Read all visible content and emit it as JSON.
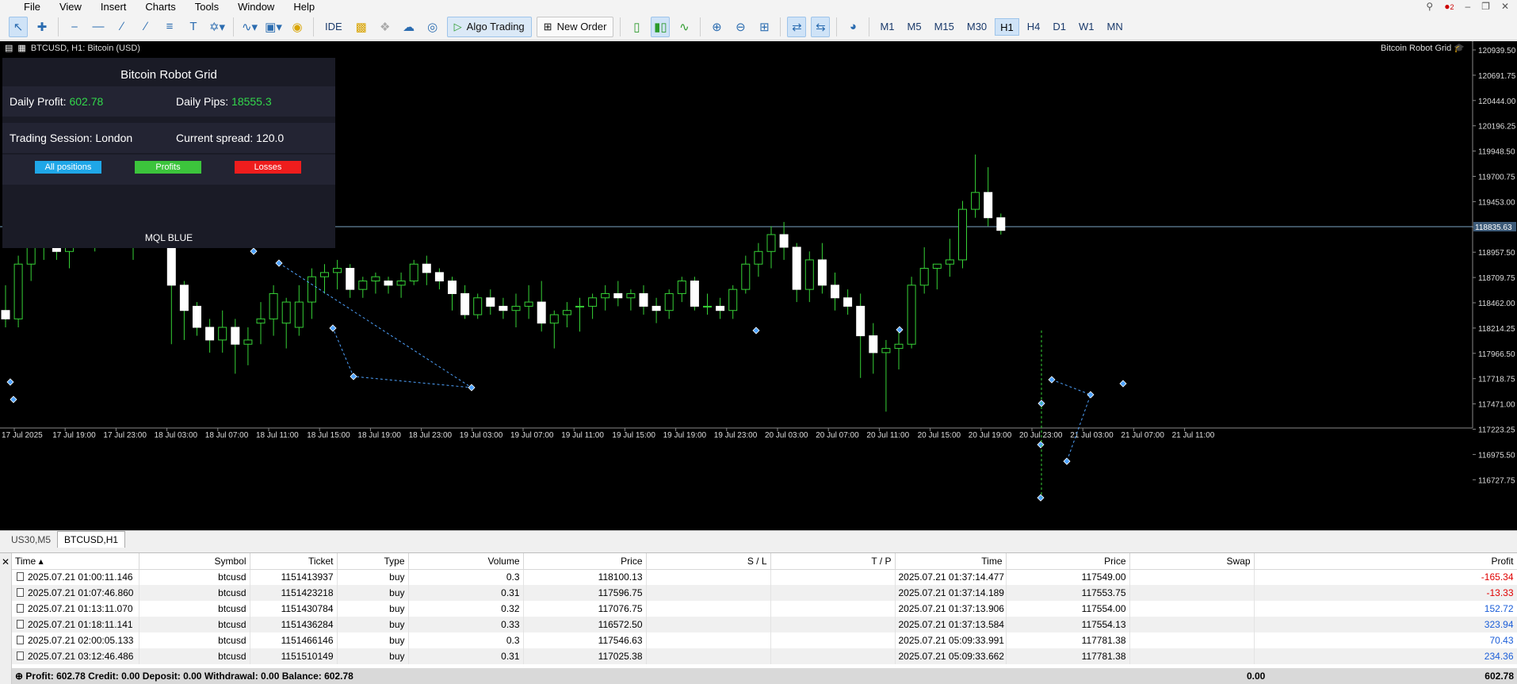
{
  "menu": [
    "File",
    "View",
    "Insert",
    "Charts",
    "Tools",
    "Window",
    "Help"
  ],
  "toolbar": {
    "ide": "IDE",
    "algo_trading": "Algo Trading",
    "new_order": "New Order",
    "timeframes": [
      "M1",
      "M5",
      "M15",
      "M30",
      "H1",
      "H4",
      "D1",
      "W1",
      "MN"
    ],
    "active_timeframe": "H1",
    "notification_count": "2"
  },
  "chart": {
    "label": "BTCUSD, H1:  Bitcoin (USD)",
    "right_label": "Bitcoin Robot Grid",
    "current_price": "118835.63",
    "price_ticks": [
      "120939.50",
      "120691.75",
      "120444.00",
      "120196.25",
      "119948.50",
      "119700.75",
      "119453.00",
      "119205.25",
      "118957.50",
      "118709.75",
      "118462.00",
      "118214.25",
      "117966.50",
      "117718.75",
      "117471.00",
      "117223.25",
      "116975.50",
      "116727.75"
    ],
    "time_ticks": [
      "17 Jul 2025",
      "17 Jul 19:00",
      "17 Jul 23:00",
      "18 Jul 03:00",
      "18 Jul 07:00",
      "18 Jul 11:00",
      "18 Jul 15:00",
      "18 Jul 19:00",
      "18 Jul 23:00",
      "19 Jul 03:00",
      "19 Jul 07:00",
      "19 Jul 11:00",
      "19 Jul 15:00",
      "19 Jul 19:00",
      "19 Jul 23:00",
      "20 Jul 03:00",
      "20 Jul 07:00",
      "20 Jul 11:00",
      "20 Jul 15:00",
      "20 Jul 19:00",
      "20 Jul 23:00",
      "21 Jul 03:00",
      "21 Jul 07:00",
      "21 Jul 11:00"
    ]
  },
  "panel": {
    "title": "Bitcoin Robot Grid",
    "daily_profit_label": "Daily Profit:",
    "daily_profit": "602.78",
    "daily_pips_label": "Daily Pips:",
    "daily_pips": "18555.3",
    "session_label": "Trading Session: London",
    "spread_label": "Current spread:",
    "spread": "120.0",
    "btn_all": "All positions",
    "btn_profits": "Profits",
    "btn_losses": "Losses",
    "brand": "MQL BLUE",
    "colors": {
      "all": "#1fa7e8",
      "profits": "#3cc43c",
      "losses": "#ef1d1d"
    }
  },
  "chart_tabs": [
    "US30,M5",
    "BTCUSD,H1"
  ],
  "trades": {
    "headers": [
      "Time",
      "Symbol",
      "Ticket",
      "Type",
      "Volume",
      "Price",
      "S / L",
      "T / P",
      "Time",
      "Price",
      "Swap",
      "Profit"
    ],
    "rows": [
      [
        "2025.07.21 01:00:11.146",
        "btcusd",
        "1151413937",
        "buy",
        "0.3",
        "118100.13",
        "",
        "",
        "2025.07.21 01:37:14.477",
        "117549.00",
        "",
        "-165.34"
      ],
      [
        "2025.07.21 01:07:46.860",
        "btcusd",
        "1151423218",
        "buy",
        "0.31",
        "117596.75",
        "",
        "",
        "2025.07.21 01:37:14.189",
        "117553.75",
        "",
        "-13.33"
      ],
      [
        "2025.07.21 01:13:11.070",
        "btcusd",
        "1151430784",
        "buy",
        "0.32",
        "117076.75",
        "",
        "",
        "2025.07.21 01:37:13.906",
        "117554.00",
        "",
        "152.72"
      ],
      [
        "2025.07.21 01:18:11.141",
        "btcusd",
        "1151436284",
        "buy",
        "0.33",
        "116572.50",
        "",
        "",
        "2025.07.21 01:37:13.584",
        "117554.13",
        "",
        "323.94"
      ],
      [
        "2025.07.21 02:00:05.133",
        "btcusd",
        "1151466146",
        "buy",
        "0.3",
        "117546.63",
        "",
        "",
        "2025.07.21 05:09:33.991",
        "117781.38",
        "",
        "70.43"
      ],
      [
        "2025.07.21 03:12:46.486",
        "btcusd",
        "1151510149",
        "buy",
        "0.31",
        "117025.38",
        "",
        "",
        "2025.07.21 05:09:33.662",
        "117781.38",
        "",
        "234.36"
      ]
    ],
    "footer": "Profit: 602.78  Credit: 0.00  Deposit: 0.00  Withdrawal: 0.00  Balance: 602.78",
    "footer_swap": "0.00",
    "footer_total": "602.78"
  },
  "chart_data": {
    "type": "candlestick",
    "ylim": [
      116600,
      121000
    ],
    "grid": false,
    "candles": [
      [
        117900,
        118200,
        117700,
        117800
      ],
      [
        117800,
        118550,
        117700,
        118450
      ],
      [
        118450,
        118900,
        118250,
        118800
      ],
      [
        118800,
        119100,
        118500,
        118950
      ],
      [
        118950,
        119050,
        118500,
        118600
      ],
      [
        118600,
        119000,
        118400,
        118900
      ],
      [
        118900,
        119300,
        118700,
        119150
      ],
      [
        119150,
        119350,
        118600,
        119000
      ],
      [
        119000,
        119400,
        118800,
        119100
      ],
      [
        119100,
        119600,
        118700,
        119250
      ],
      [
        118750,
        119300,
        118500,
        119150
      ],
      [
        119150,
        119500,
        118900,
        119300
      ],
      [
        119300,
        119400,
        118700,
        118900
      ],
      [
        118900,
        119000,
        117500,
        118200
      ],
      [
        118200,
        118250,
        117550,
        117900
      ],
      [
        117950,
        118000,
        117600,
        117700
      ],
      [
        117700,
        117800,
        117400,
        117550
      ],
      [
        117550,
        117900,
        117400,
        117700
      ],
      [
        117700,
        117800,
        117150,
        117500
      ],
      [
        117500,
        117700,
        117250,
        117550
      ],
      [
        117750,
        118000,
        117500,
        117800
      ],
      [
        117800,
        118200,
        117600,
        118100
      ],
      [
        117750,
        118050,
        117450,
        118000
      ],
      [
        117700,
        118200,
        117600,
        118000
      ],
      [
        118000,
        118400,
        117800,
        118300
      ],
      [
        118300,
        118450,
        118100,
        118350
      ],
      [
        118350,
        118500,
        118150,
        118400
      ],
      [
        118400,
        118450,
        118050,
        118150
      ],
      [
        118150,
        118300,
        118050,
        118250
      ],
      [
        118250,
        118350,
        118100,
        118300
      ],
      [
        118250,
        118300,
        118100,
        118200
      ],
      [
        118200,
        118350,
        118050,
        118250
      ],
      [
        118250,
        118500,
        118200,
        118450
      ],
      [
        118450,
        118550,
        118200,
        118350
      ],
      [
        118350,
        118400,
        118150,
        118250
      ],
      [
        118250,
        118300,
        117900,
        118100
      ],
      [
        118100,
        118200,
        117800,
        117850
      ],
      [
        117850,
        118100,
        117800,
        118050
      ],
      [
        118050,
        118150,
        117850,
        117950
      ],
      [
        117950,
        118050,
        117800,
        117900
      ],
      [
        117900,
        118100,
        117700,
        117950
      ],
      [
        117950,
        118200,
        117800,
        118000
      ],
      [
        118000,
        118250,
        117650,
        117750
      ],
      [
        117750,
        117900,
        117450,
        117850
      ],
      [
        117850,
        118000,
        117700,
        117900
      ],
      [
        117950,
        118050,
        117650,
        117950
      ],
      [
        117950,
        118100,
        117800,
        118050
      ],
      [
        118050,
        118200,
        117900,
        118100
      ],
      [
        118100,
        118250,
        117950,
        118050
      ],
      [
        118050,
        118150,
        117900,
        118100
      ],
      [
        118100,
        118200,
        117850,
        117950
      ],
      [
        117950,
        118050,
        117750,
        117900
      ],
      [
        117900,
        118150,
        117800,
        118100
      ],
      [
        118100,
        118300,
        118000,
        118250
      ],
      [
        118250,
        118300,
        117900,
        117950
      ],
      [
        117950,
        118100,
        117850,
        117950
      ],
      [
        117950,
        118050,
        117800,
        117900
      ],
      [
        117900,
        118200,
        117800,
        118150
      ],
      [
        118150,
        118550,
        118100,
        118450
      ],
      [
        118450,
        118700,
        118300,
        118600
      ],
      [
        118600,
        118900,
        118400,
        118800
      ],
      [
        118800,
        118950,
        118500,
        118650
      ],
      [
        118650,
        118700,
        118000,
        118150
      ],
      [
        118150,
        118600,
        118000,
        118500
      ],
      [
        118500,
        118700,
        118100,
        118200
      ],
      [
        118200,
        118350,
        117900,
        118050
      ],
      [
        118050,
        118150,
        117850,
        117950
      ],
      [
        117950,
        118100,
        117100,
        117600
      ],
      [
        117600,
        117750,
        117150,
        117400
      ],
      [
        117400,
        117550,
        116700,
        117450
      ],
      [
        117450,
        117700,
        117200,
        117500
      ],
      [
        117500,
        118300,
        117450,
        118200
      ],
      [
        118200,
        118650,
        118100,
        118400
      ],
      [
        118400,
        118450,
        118150,
        118450
      ],
      [
        118450,
        118750,
        118300,
        118500
      ],
      [
        118500,
        119200,
        118400,
        119100
      ],
      [
        119100,
        119750,
        119000,
        119300
      ],
      [
        119300,
        119600,
        118900,
        119000
      ],
      [
        119000,
        119050,
        118800,
        118850
      ]
    ]
  }
}
